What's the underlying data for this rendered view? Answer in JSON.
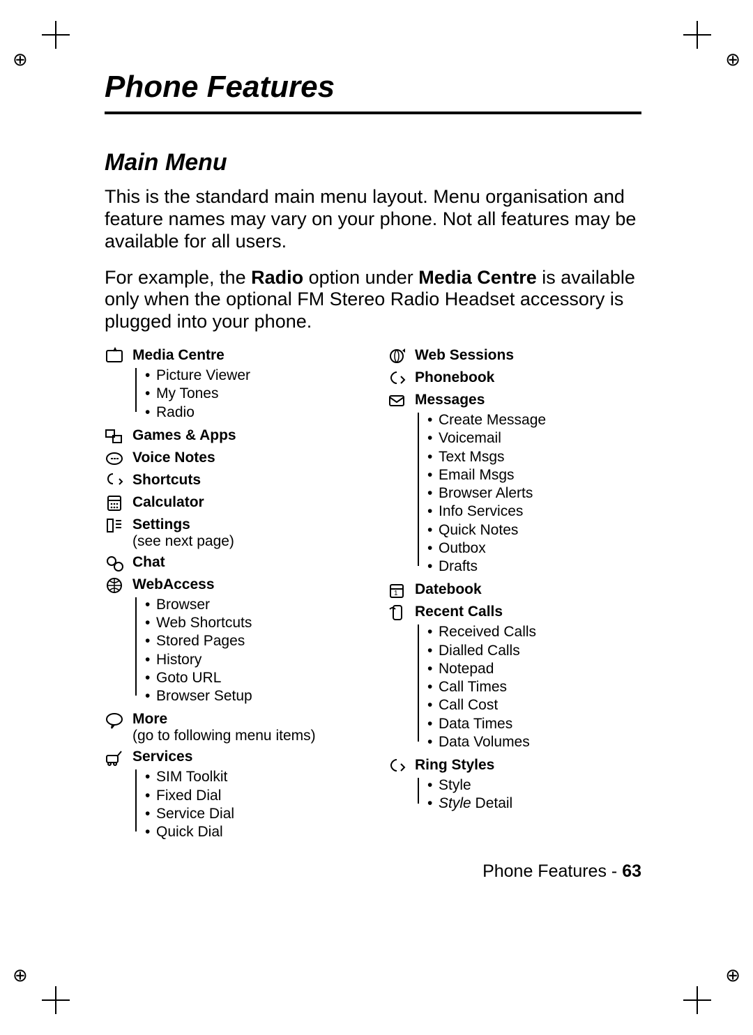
{
  "page_title": "Phone Features",
  "section_title": "Main Menu",
  "para1": "This is the standard main menu layout. Menu organisation and feature names may vary on your phone. Not all features may be available for all users.",
  "para2_pre": "For example, the ",
  "para2_b1": "Radio",
  "para2_mid": " option under ",
  "para2_b2": "Media Centre",
  "para2_post": " is available only when the optional FM Stereo Radio Headset accessory is plugged into your phone.",
  "left": [
    {
      "title": "Media Centre",
      "icon": "media-centre-icon",
      "items": [
        "Picture Viewer",
        "My Tones",
        "Radio"
      ]
    },
    {
      "title": "Games & Apps",
      "icon": "games-apps-icon"
    },
    {
      "title": "Voice Notes",
      "icon": "voice-notes-icon"
    },
    {
      "title": "Shortcuts",
      "icon": "shortcuts-icon"
    },
    {
      "title": "Calculator",
      "icon": "calculator-icon"
    },
    {
      "title": "Settings",
      "icon": "settings-icon",
      "note": "(see next page)"
    },
    {
      "title": "Chat",
      "icon": "chat-icon"
    },
    {
      "title": "WebAccess",
      "icon": "webaccess-icon",
      "items": [
        "Browser",
        "Web Shortcuts",
        "Stored Pages",
        "History",
        "Goto URL",
        "Browser Setup"
      ]
    },
    {
      "title": "More",
      "icon": "more-icon",
      "note": "(go to following menu items)"
    },
    {
      "title": "Services",
      "icon": "services-icon",
      "items": [
        "SIM Toolkit",
        "Fixed Dial",
        "Service Dial",
        "Quick Dial"
      ]
    }
  ],
  "right": [
    {
      "title": "Web Sessions",
      "icon": "web-sessions-icon"
    },
    {
      "title": "Phonebook",
      "icon": "phonebook-icon"
    },
    {
      "title": "Messages",
      "icon": "messages-icon",
      "items": [
        "Create Message",
        "Voicemail",
        "Text Msgs",
        "Email Msgs",
        "Browser Alerts",
        "Info Services",
        "Quick Notes",
        "Outbox",
        "Drafts"
      ]
    },
    {
      "title": "Datebook",
      "icon": "datebook-icon"
    },
    {
      "title": "Recent Calls",
      "icon": "recent-calls-icon",
      "items": [
        "Received Calls",
        "Dialled Calls",
        "Notepad",
        "Call Times",
        "Call Cost",
        "Data Times",
        "Data Volumes"
      ]
    },
    {
      "title": "Ring Styles",
      "icon": "ring-styles-icon",
      "items": [
        "Style",
        "Style Detail"
      ],
      "italicLast": true
    }
  ],
  "footer_label": "Phone Features - ",
  "footer_page": "63"
}
